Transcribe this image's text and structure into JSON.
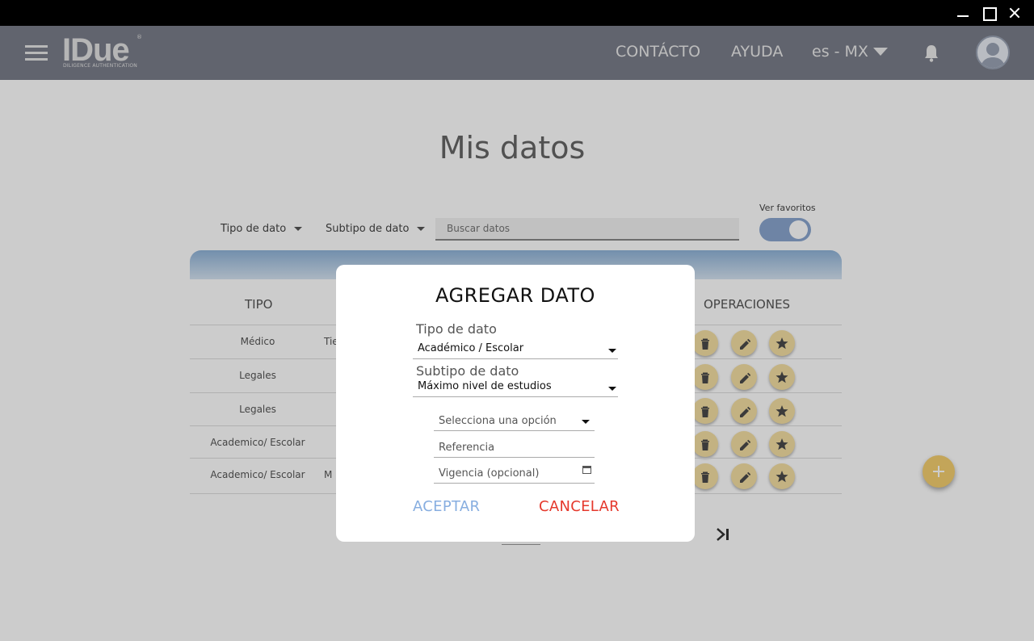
{
  "window": {
    "minimize_icon": "minimize-icon",
    "maximize_icon": "maximize-icon",
    "close_icon": "close-icon"
  },
  "header": {
    "logo_text": "IDue",
    "logo_mark": "®",
    "logo_subtitle": "DILIGENCE AUTHENTICATION",
    "nav": {
      "contact": "CONTÁCTO",
      "help": "AYUDA",
      "language": "es - MX"
    },
    "colors": {
      "header_bg": "#7a7e8a"
    }
  },
  "main": {
    "title": "Mis datos",
    "filters": {
      "tipo": "Tipo de dato",
      "subtipo": "Subtipo de dato"
    },
    "search": {
      "placeholder": "Buscar datos",
      "value": ""
    },
    "favorites": {
      "label": "Ver favoritos",
      "on": true
    },
    "table": {
      "headers": {
        "tipo": "TIPO",
        "ops": "OPERACIONES"
      },
      "rows": [
        {
          "tipo": "Médico",
          "desc": "Tie"
        },
        {
          "tipo": "Legales",
          "desc": ""
        },
        {
          "tipo": "Legales",
          "desc": ""
        },
        {
          "tipo": "Academico/ Escolar",
          "desc": ""
        },
        {
          "tipo": "Academico/ Escolar",
          "desc": "M"
        }
      ]
    }
  },
  "modal": {
    "title": "AGREGAR DATO",
    "tipo_label": "Tipo de dato",
    "tipo_value": "Académico / Escolar",
    "subtipo_label": "Subtipo de dato",
    "subtipo_value": "Máximo nivel de estudios",
    "option_placeholder": "Selecciona una opción",
    "reference_placeholder": "Referencia",
    "validity_placeholder": "Vigencia (opcional)",
    "accept": "ACEPTAR",
    "cancel": "CANCELAR",
    "colors": {
      "accept": "#87aee0",
      "cancel": "#e5382c"
    }
  }
}
